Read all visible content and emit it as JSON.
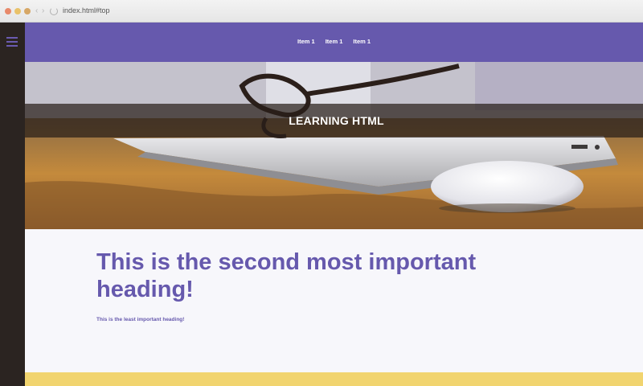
{
  "browser": {
    "url": "index.html#top"
  },
  "nav": {
    "items": [
      {
        "label": "Item 1"
      },
      {
        "label": "Item 1"
      },
      {
        "label": "Item 1"
      }
    ]
  },
  "hero": {
    "title": "LEARNING HTML"
  },
  "content": {
    "heading": "This is the second most important heading!",
    "subheading": "This is the least important heading!"
  },
  "colors": {
    "brand_purple": "#6659ad",
    "sidebar_dark": "#2b2421",
    "footer_yellow": "#f1d46f"
  }
}
